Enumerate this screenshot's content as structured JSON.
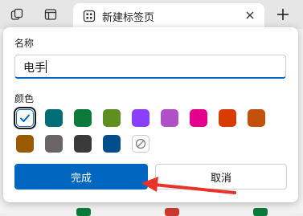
{
  "tabs": {
    "active_title": "新建标签页"
  },
  "dialog": {
    "name_label": "名称",
    "name_value": "电手",
    "color_label": "颜色",
    "colors": [
      {
        "name": "blue",
        "hex": "#ffffff",
        "selected": true
      },
      {
        "name": "teal",
        "hex": "#006d77",
        "selected": false
      },
      {
        "name": "green",
        "hex": "#0b7a3b",
        "selected": false
      },
      {
        "name": "olive",
        "hex": "#5e8f1f",
        "selected": false
      },
      {
        "name": "purple",
        "hex": "#8a3ffc",
        "selected": false
      },
      {
        "name": "violet",
        "hex": "#b04fc8",
        "selected": false
      },
      {
        "name": "magenta",
        "hex": "#e3008c",
        "selected": false
      },
      {
        "name": "red-orange",
        "hex": "#d83b01",
        "selected": false
      },
      {
        "name": "orange",
        "hex": "#c4500d",
        "selected": false
      },
      {
        "name": "brown",
        "hex": "#9a5a00",
        "selected": false
      },
      {
        "name": "gray",
        "hex": "#6a6564",
        "selected": false
      },
      {
        "name": "dark-gray",
        "hex": "#3a3a3a",
        "selected": false
      },
      {
        "name": "dark-blue",
        "hex": "#004e8c",
        "selected": false
      },
      {
        "name": "no-color",
        "hex": "",
        "selected": false
      }
    ],
    "done_label": "完成",
    "cancel_label": "取消"
  },
  "accent": "#0067c0",
  "annotation_arrow_color": "#e8332a"
}
